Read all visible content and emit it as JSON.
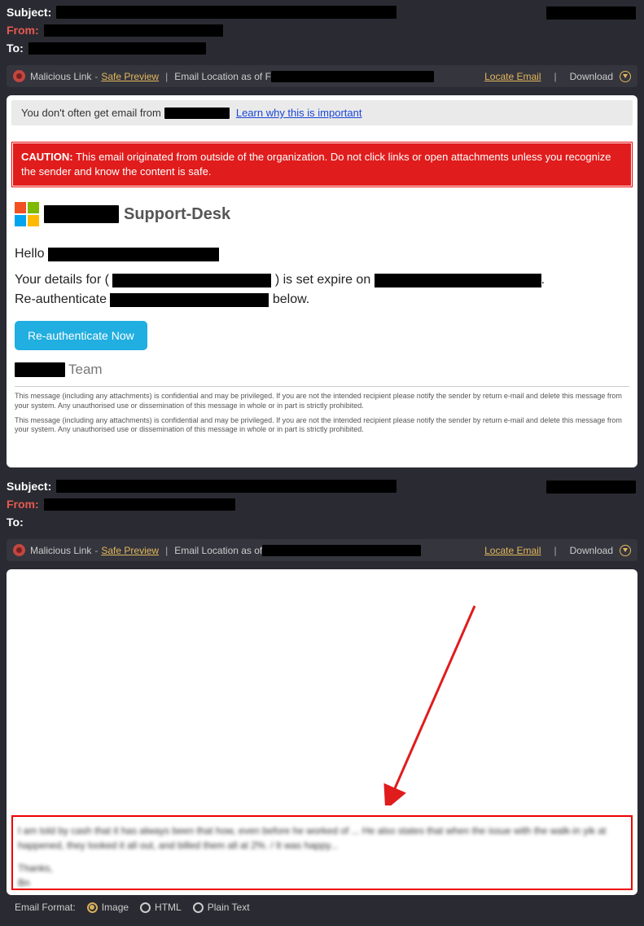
{
  "panel1": {
    "labels": {
      "subject": "Subject:",
      "from": "From:",
      "to": "To:"
    },
    "toolbar": {
      "malicious": "Malicious Link",
      "safe_preview": "Safe Preview",
      "location_prefix": "Email Location as of F",
      "locate": "Locate Email",
      "download": "Download"
    },
    "infotip": {
      "prefix": "You don't often get email from",
      "learn": "Learn why this is important"
    },
    "caution": {
      "label": "CAUTION:",
      "text": "This email originated from outside of the organization. Do not click links or open attachments unless you recognize the sender and know the content is safe."
    },
    "body": {
      "support_desk": "Support-Desk",
      "hello": "Hello",
      "line1a": "Your details for (",
      "line1b": ") is set expire on",
      "line2a": "Re-authenticate",
      "line2b": "below.",
      "button": "Re-authenticate Now",
      "team": "Team",
      "disclaimer": "This message (including any attachments) is confidential and may be privileged. If you are not the intended recipient please notify the sender by return e-mail and delete this message from your system. Any unauthorised use or dissemination of this message in whole or in part is strictly prohibited."
    }
  },
  "panel2": {
    "labels": {
      "subject": "Subject:",
      "from": "From:",
      "to": "To:"
    },
    "toolbar": {
      "malicious": "Malicious Link",
      "safe_preview": "Safe Preview",
      "location_prefix": "Email Location as of",
      "locate": "Locate Email",
      "download": "Download"
    },
    "blurred": {
      "line1": "I am told by cash that it has always been that how, even before he worked of ... He also states that when the issue with the walk-in yik at happened, they looked it all out, and billed them all at 2%. / It was happy...",
      "line2": "Thanks,",
      "line3": "Bn"
    },
    "format": {
      "label": "Email Format:",
      "opt1": "Image",
      "opt2": "HTML",
      "opt3": "Plain Text"
    }
  }
}
